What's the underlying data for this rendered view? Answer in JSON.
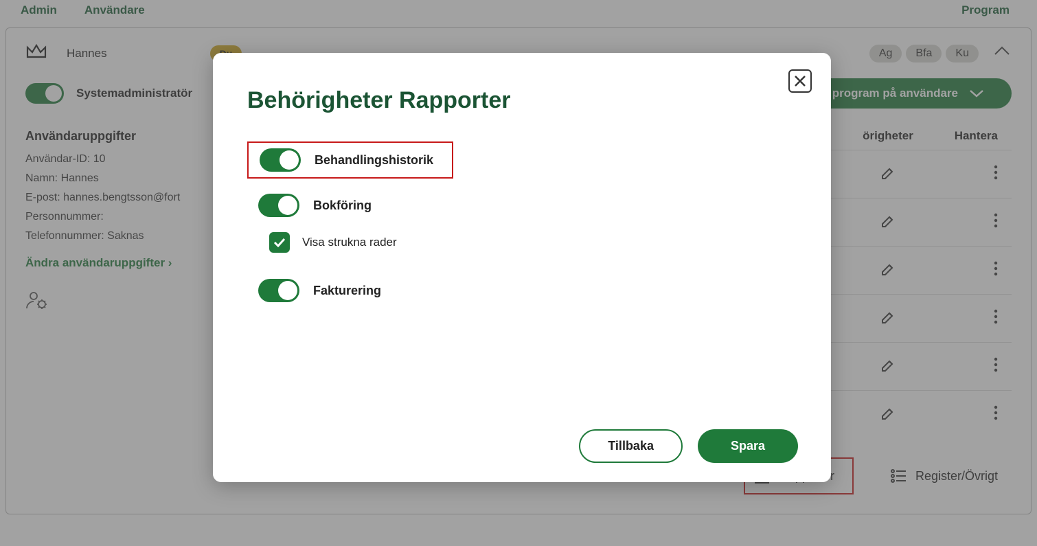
{
  "tabs": {
    "admin": "Admin",
    "users": "Användare",
    "program": "Program"
  },
  "header": {
    "name": "Hannes",
    "you_pill": "Du",
    "pills": [
      "Ag",
      "Bfa",
      "Ku"
    ]
  },
  "sysadmin_label": "Systemadministratör",
  "big_button": "program på användare",
  "details": {
    "heading": "Användaruppgifter",
    "id": "Användar-ID: 10",
    "name": "Namn: Hannes",
    "email": "E-post: hannes.bengtsson@fort",
    "pnr": "Personnummer:",
    "phone": "Telefonnummer: Saknas",
    "edit_link": "Ändra användaruppgifter ›"
  },
  "table": {
    "col_beh": "örigheter",
    "col_han": "Hantera"
  },
  "bottom": {
    "rapporter": "Rapporter",
    "register": "Register/Övrigt"
  },
  "modal": {
    "title": "Behörigheter Rapporter",
    "perm1": "Behandlingshistorik",
    "perm2": "Bokföring",
    "perm2_sub": "Visa strukna rader",
    "perm3": "Fakturering",
    "back": "Tillbaka",
    "save": "Spara"
  }
}
